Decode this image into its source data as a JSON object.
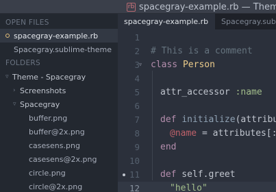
{
  "window": {
    "file_badge": "rb",
    "title": "spacegray-example.rb — Theme -"
  },
  "sidebar": {
    "open_files_header": "OPEN FILES",
    "open_files": [
      {
        "label": "spacegray-example.rb",
        "active": true
      },
      {
        "label": "Spacegray.sublime-theme",
        "active": false
      }
    ],
    "folders_header": "FOLDERS",
    "tree": [
      {
        "label": "Theme - Spacegray",
        "expanded": true
      },
      {
        "label": "Screenshots",
        "expanded": false
      },
      {
        "label": "Spacegray",
        "expanded": true
      },
      {
        "label": "buffer.png"
      },
      {
        "label": "buffer@2x.png"
      },
      {
        "label": "casesens.png"
      },
      {
        "label": "casesens@2x.png"
      },
      {
        "label": "circle.png"
      },
      {
        "label": "circle@2x.png"
      }
    ]
  },
  "tabs": [
    {
      "label": "spacegray-example.rb",
      "active": true
    },
    {
      "label": "Spacegray.sublim",
      "active": false
    }
  ],
  "editor": {
    "line_numbers": [
      "1",
      "2",
      "3",
      "4",
      "5",
      "6",
      "7",
      "8",
      "9",
      "10",
      "11",
      "12"
    ],
    "current_line": 12,
    "lines": {
      "l2_comment": "# This is a comment",
      "l3_kw": "class",
      "l3_class": "Person",
      "l5_method": "attr_accessor",
      "l5_sym": ":name",
      "l7_kw": "def",
      "l7_fn": "initialize",
      "l7_rest": "(attribute",
      "l8_ivar": "@name",
      "l8_rest": " = attributes[:na",
      "l9_kw": "end",
      "l11_kw": "def",
      "l11_rest": " self.greet",
      "l12_str": "\"hello\""
    }
  }
}
